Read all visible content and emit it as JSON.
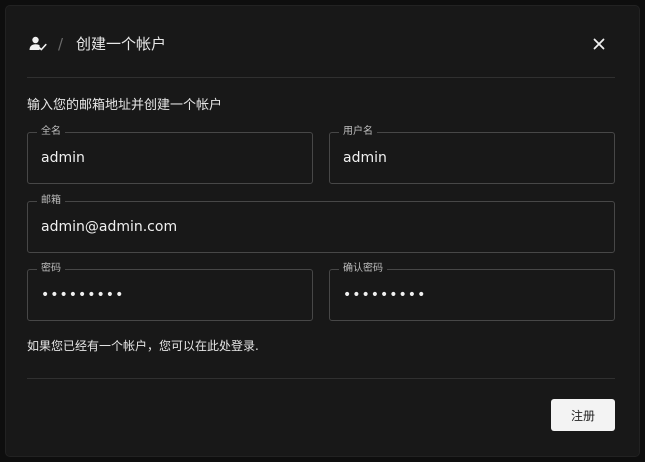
{
  "dialog": {
    "title": "创建一个帐户",
    "separator": "/",
    "subtitle": "输入您的邮箱地址并创建一个帐户",
    "login_hint": "如果您已经有一个帐户，您可以在此处登录.",
    "register_label": "注册"
  },
  "fields": {
    "full_name": {
      "label": "全名",
      "value": "admin"
    },
    "username": {
      "label": "用户名",
      "value": "admin"
    },
    "email": {
      "label": "邮箱",
      "value": "admin@admin.com"
    },
    "password": {
      "label": "密码",
      "value": "•••••••••"
    },
    "confirm_password": {
      "label": "确认密码",
      "value": "•••••••••"
    }
  },
  "icons": {
    "header": "user-check-icon",
    "close": "close-icon"
  },
  "colors": {
    "dialog_background": "#181818",
    "field_border": "#474747",
    "button_background": "#f3f3f3",
    "text": "#e6e6e6"
  }
}
